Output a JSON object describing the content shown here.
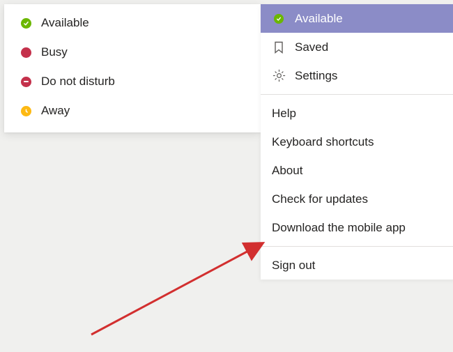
{
  "status_menu": {
    "items": [
      {
        "key": "available",
        "label": "Available"
      },
      {
        "key": "busy",
        "label": "Busy"
      },
      {
        "key": "dnd",
        "label": "Do not disturb"
      },
      {
        "key": "away",
        "label": "Away"
      }
    ]
  },
  "main_menu": {
    "status": {
      "label": "Available"
    },
    "saved": {
      "label": "Saved"
    },
    "settings": {
      "label": "Settings"
    },
    "help": {
      "label": "Help"
    },
    "keyboard_shortcuts": {
      "label": "Keyboard shortcuts"
    },
    "about": {
      "label": "About"
    },
    "check_updates": {
      "label": "Check for updates"
    },
    "download_app": {
      "label": "Download the mobile app"
    },
    "sign_out": {
      "label": "Sign out"
    }
  },
  "colors": {
    "selected_bg": "#8b8cc7",
    "available": "#6bb700",
    "busy": "#c4314b",
    "away": "#fdb913",
    "arrow": "#d22f2f"
  }
}
